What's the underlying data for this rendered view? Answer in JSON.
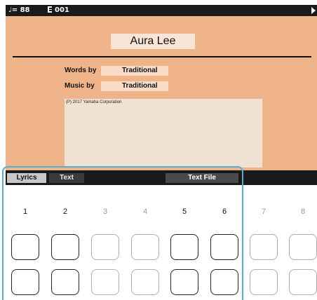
{
  "status_bar": {
    "tempo": "♩= 88",
    "bar_number": "001",
    "bar_icon": "bar-counter-icon",
    "play_icon": "play-icon"
  },
  "lyrics": {
    "title": "Aura Lee",
    "credits": [
      {
        "label": "Words by",
        "value": "Traditional"
      },
      {
        "label": "Music by",
        "value": "Traditional"
      }
    ],
    "copyright": "(P) 2017 Yamaha Corporation"
  },
  "tabs": [
    {
      "label": "Lyrics",
      "active": true
    },
    {
      "label": "Text",
      "active": false
    }
  ],
  "text_file_button": "Text File",
  "button_columns": [
    {
      "number": "1",
      "active": true
    },
    {
      "number": "2",
      "active": true
    },
    {
      "number": "3",
      "active": false
    },
    {
      "number": "4",
      "active": false
    },
    {
      "number": "5",
      "active": true
    },
    {
      "number": "6",
      "active": true
    },
    {
      "number": "7",
      "active": false
    },
    {
      "number": "8",
      "active": false
    }
  ],
  "colors": {
    "lyrics_background": "#f0b48a",
    "highlight_frame": "#4fb0d6",
    "bar_background": "#1a1a1a"
  }
}
